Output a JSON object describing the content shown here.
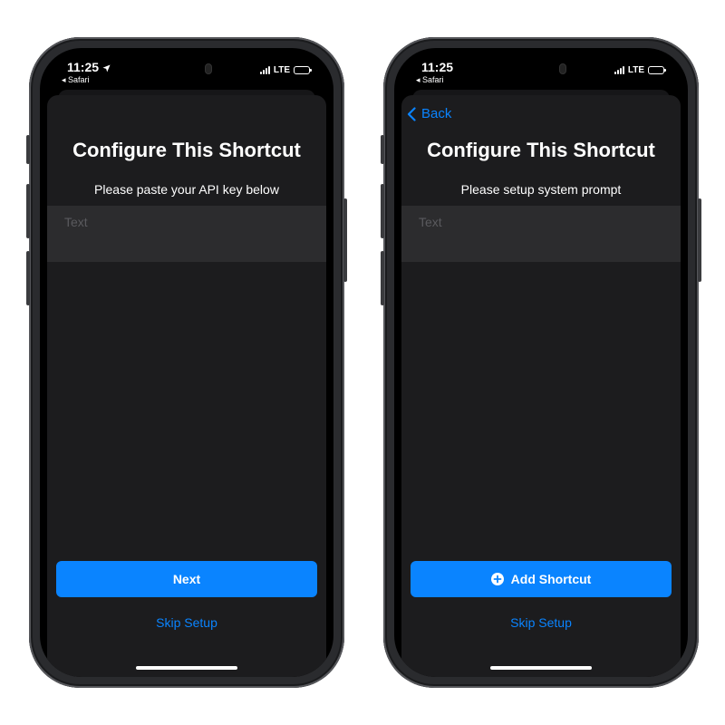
{
  "colors": {
    "accent": "#0a84ff",
    "sheet_bg": "#1c1c1e",
    "field_bg": "#2c2c2e"
  },
  "screens": [
    {
      "status": {
        "time": "11:25",
        "back_app": "Safari",
        "network": "LTE",
        "location_icon": "location-arrow-icon"
      },
      "sheet": {
        "back_label": "",
        "title": "Configure This Shortcut",
        "subtitle": "Please paste your API key below",
        "field_placeholder": "Text",
        "primary_button": "Next",
        "skip_label": "Skip Setup"
      }
    },
    {
      "status": {
        "time": "11:25",
        "back_app": "Safari",
        "network": "LTE"
      },
      "sheet": {
        "back_label": "Back",
        "title": "Configure This Shortcut",
        "subtitle": "Please setup system prompt",
        "field_placeholder": "Text",
        "primary_button": "Add Shortcut",
        "primary_icon": "plus-circle-icon",
        "skip_label": "Skip Setup"
      }
    }
  ]
}
